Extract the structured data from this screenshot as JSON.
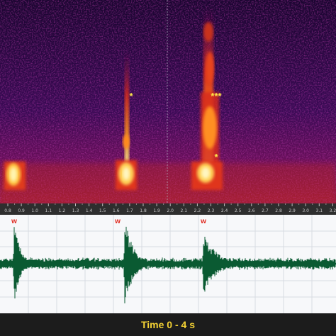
{
  "colors": {
    "spectrogram_bg": "#1b0630",
    "waveform": "#0a5a32",
    "footer_text": "#f4d234",
    "call_marker": "#e0281e",
    "annotation_marker": "#ffe94a"
  },
  "time_axis": {
    "ticks": [
      "0.8",
      "0.9",
      "1.0",
      "1.1",
      "1.2",
      "1.3",
      "1.4",
      "1.5",
      "1.6",
      "1.7",
      "1.8",
      "1.9",
      "2.0",
      "2.1",
      "2.2",
      "2.3",
      "2.4",
      "2.5",
      "2.6",
      "2.7",
      "2.8",
      "2.9",
      "3.0",
      "3.1",
      "3.2"
    ]
  },
  "waveform_markers": [
    "w",
    "w",
    "w"
  ],
  "spectrogram_annotations": [
    "*",
    "***",
    "*"
  ],
  "footer": {
    "label": "Time 0 - 4 s"
  }
}
